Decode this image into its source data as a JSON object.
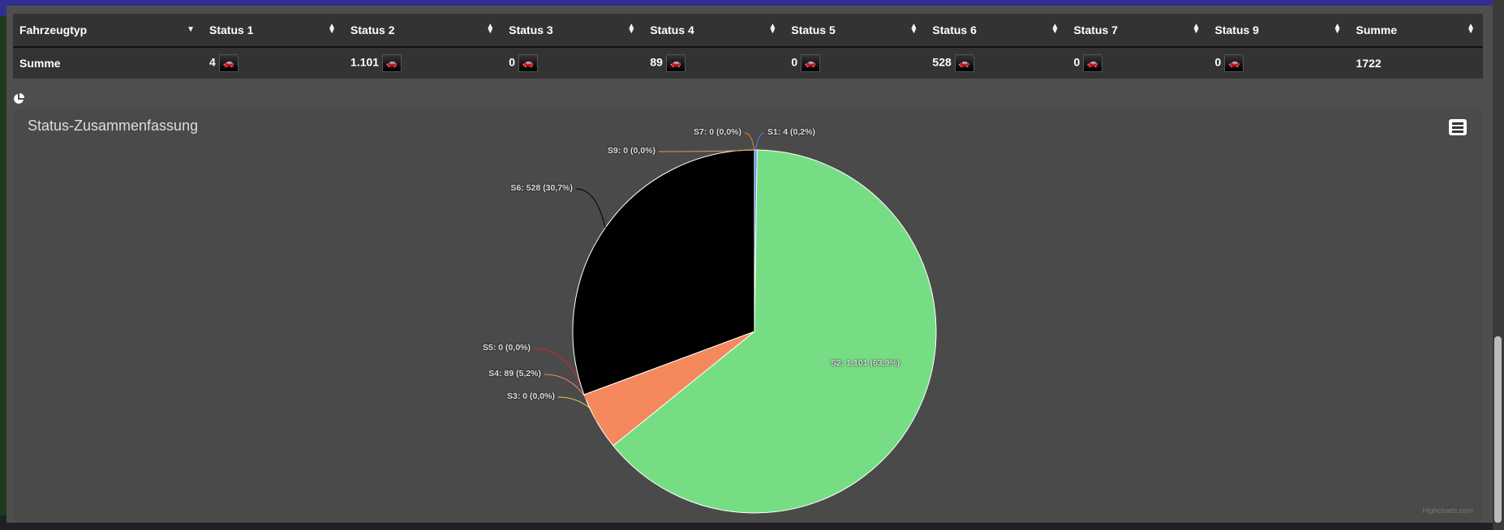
{
  "table": {
    "headers": [
      "Fahrzeugtyp",
      "Status 1",
      "Status 2",
      "Status 3",
      "Status 4",
      "Status 5",
      "Status 6",
      "Status 7",
      "Status 9",
      "Summe"
    ],
    "row": {
      "label": "Summe",
      "values": [
        "4",
        "1.101",
        "0",
        "89",
        "0",
        "528",
        "0",
        "0"
      ],
      "total": "1722"
    }
  },
  "chart": {
    "title": "Status-Zusammenfassung",
    "credits": "Highcharts.com",
    "menu_icon": "hamburger-icon"
  },
  "chart_data": {
    "type": "pie",
    "title": "Status-Zusammenfassung",
    "slices": [
      {
        "name": "S1",
        "value": 4,
        "percent": 0.2,
        "label": "S1: 4 (0,2%)",
        "color": "#4a86e8"
      },
      {
        "name": "S2",
        "value": 1101,
        "percent": 63.9,
        "label": "S2: 1.101 (63,9%)",
        "color": "#77dd85"
      },
      {
        "name": "S3",
        "value": 0,
        "percent": 0.0,
        "label": "S3: 0 (0,0%)",
        "color": "#e8c84a"
      },
      {
        "name": "S4",
        "value": 89,
        "percent": 5.2,
        "label": "S4: 89 (5,2%)",
        "color": "#f5885c"
      },
      {
        "name": "S5",
        "value": 0,
        "percent": 0.0,
        "label": "S5: 0 (0,0%)",
        "color": "#e02020"
      },
      {
        "name": "S6",
        "value": 528,
        "percent": 30.7,
        "label": "S6: 528 (30,7%)",
        "color": "#000000"
      },
      {
        "name": "S7",
        "value": 0,
        "percent": 0.0,
        "label": "S7: 0 (0,0%)",
        "color": "#e8821e"
      },
      {
        "name": "S9",
        "value": 0,
        "percent": 0.0,
        "label": "S9: 0 (0,0%)",
        "color": "#d4aa40"
      }
    ]
  }
}
